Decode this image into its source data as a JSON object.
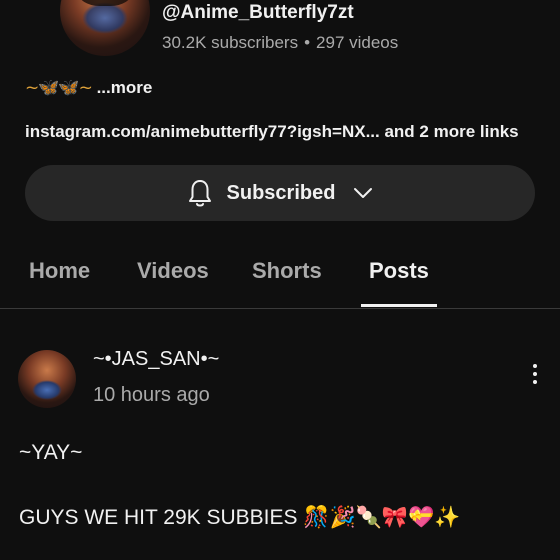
{
  "channel": {
    "handle": "@Anime_Butterfly7zt",
    "subscribers": "30.2K subscribers",
    "separator": "•",
    "videos": "297 videos",
    "description_prefix": "~🦋🦋~",
    "more_label": "...more",
    "links_text": "instagram.com/animebutterfly77?igsh=NX... and 2 more links"
  },
  "subscribe_button": {
    "label": "Subscribed",
    "icon": "bell-icon",
    "chevron": "chevron-down-icon"
  },
  "tabs": [
    {
      "label": "Home",
      "active": false
    },
    {
      "label": "Videos",
      "active": false
    },
    {
      "label": "Shorts",
      "active": false
    },
    {
      "label": "Posts",
      "active": true
    }
  ],
  "post": {
    "author": "~•JAS_SAN•~",
    "time": "10 hours ago",
    "line1": "~YAY~",
    "line2": "GUYS WE HIT 29K SUBBIES",
    "line2_emojis": "🎊🎉🍡🎀💝✨",
    "menu_icon": "more-vert-icon"
  },
  "colors": {
    "background": "#0f0f0f",
    "button_bg": "#272727",
    "text_primary": "#f1f1f1",
    "text_secondary": "#aaaaaa"
  }
}
